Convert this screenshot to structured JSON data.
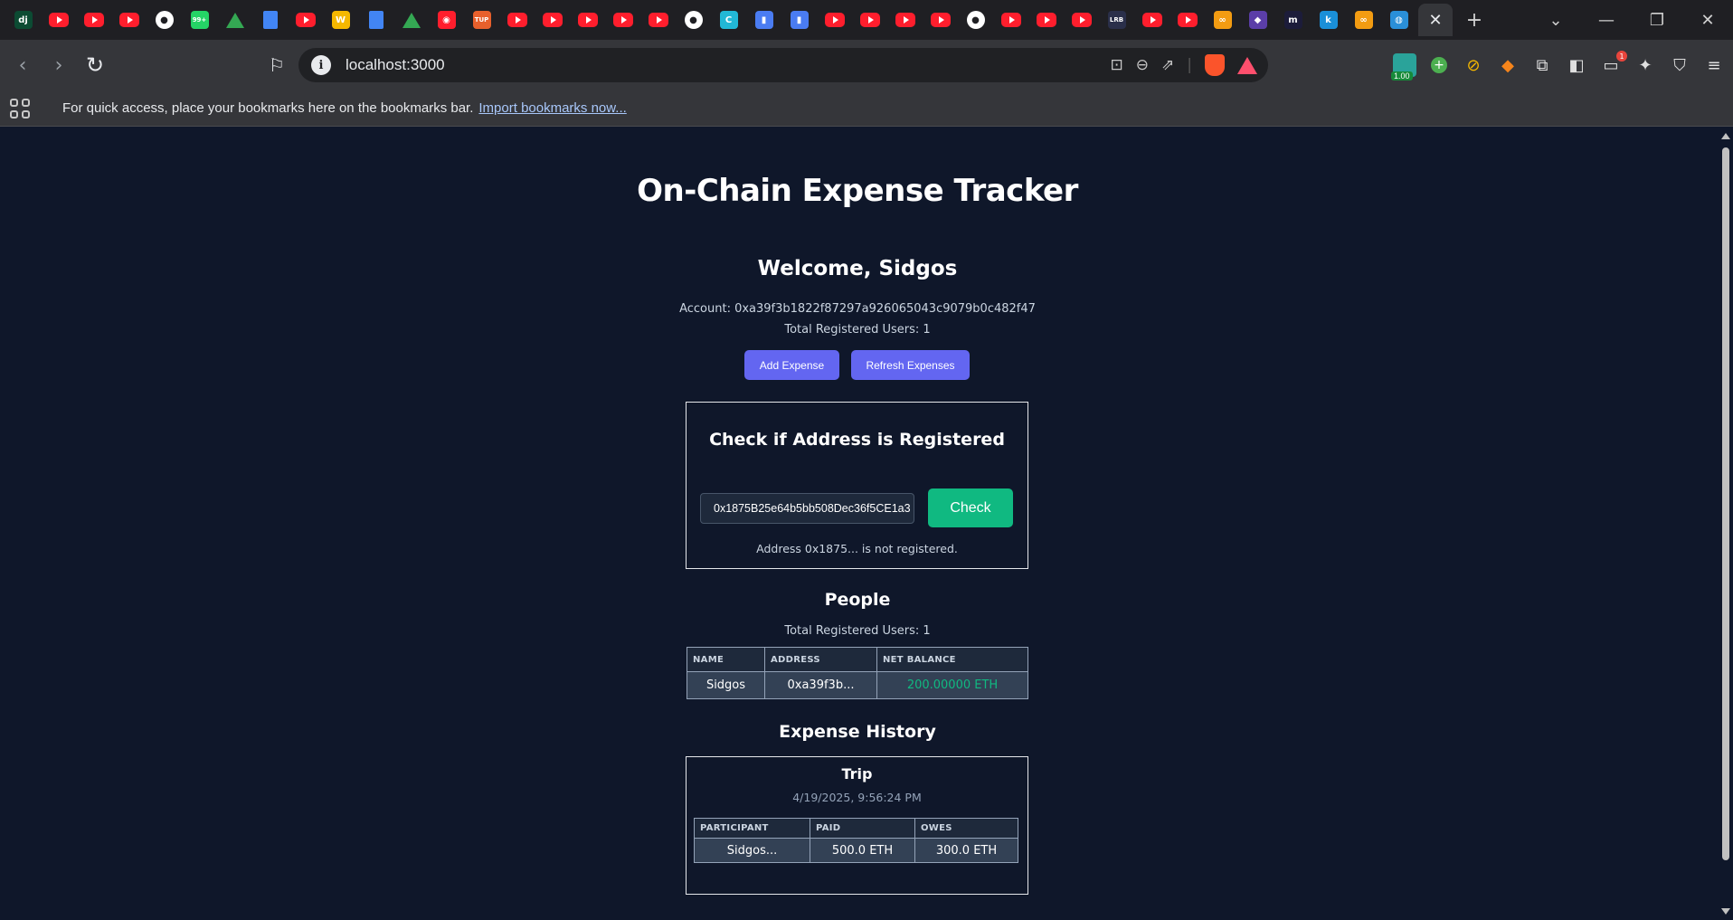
{
  "browser": {
    "tabs": [
      {
        "icon": "dj-icon",
        "glyph": "dj",
        "color": "#0c4b33"
      },
      {
        "icon": "youtube-icon"
      },
      {
        "icon": "youtube-icon"
      },
      {
        "icon": "youtube-icon"
      },
      {
        "icon": "github-icon"
      },
      {
        "icon": "green-chat-icon",
        "glyph": "99+",
        "color": "#25d366"
      },
      {
        "icon": "google-drive-icon"
      },
      {
        "icon": "google-docs-icon"
      },
      {
        "icon": "youtube-icon"
      },
      {
        "icon": "w-app-icon",
        "glyph": "W",
        "color": "#f5b800"
      },
      {
        "icon": "google-docs-icon"
      },
      {
        "icon": "google-drive-icon"
      },
      {
        "icon": "youtube-music-icon",
        "glyph": "◉",
        "color": "#ff1e2d"
      },
      {
        "icon": "tup-icon",
        "glyph": "TUP",
        "color": "#e8602c"
      },
      {
        "icon": "youtube-icon"
      },
      {
        "icon": "youtube-icon"
      },
      {
        "icon": "youtube-icon"
      },
      {
        "icon": "youtube-icon"
      },
      {
        "icon": "youtube-icon"
      },
      {
        "icon": "github-icon"
      },
      {
        "icon": "c-app-icon",
        "glyph": "C",
        "color": "#22b8d6"
      },
      {
        "icon": "bar-chart-icon",
        "glyph": "▮",
        "color": "#4a7cf2"
      },
      {
        "icon": "bar-chart-icon",
        "glyph": "▮",
        "color": "#4a7cf2"
      },
      {
        "icon": "youtube-icon"
      },
      {
        "icon": "youtube-icon"
      },
      {
        "icon": "youtube-icon"
      },
      {
        "icon": "youtube-icon"
      },
      {
        "icon": "github-icon"
      },
      {
        "icon": "youtube-icon"
      },
      {
        "icon": "youtube-icon"
      },
      {
        "icon": "youtube-icon"
      },
      {
        "icon": "lrb-icon",
        "glyph": "LRB",
        "color": "#2a2f4a"
      },
      {
        "icon": "youtube-icon"
      },
      {
        "icon": "youtube-icon"
      },
      {
        "icon": "infinity-icon",
        "glyph": "∞",
        "color": "#f39c12"
      },
      {
        "icon": "gamepad-icon",
        "glyph": "◆",
        "color": "#5b3ea8"
      },
      {
        "icon": "m-app-icon",
        "glyph": "m",
        "color": "#1c1c3a"
      },
      {
        "icon": "k-app-icon",
        "glyph": "k",
        "color": "#1a8fd8"
      },
      {
        "icon": "infinity-icon",
        "glyph": "∞",
        "color": "#f39c12"
      },
      {
        "icon": "globe-icon",
        "glyph": "◍",
        "color": "#2a8fd8"
      }
    ],
    "active_tab_close": "✕",
    "new_tab": "+",
    "url": "localhost:3000",
    "ext_badge": "1.00",
    "notif_count": "1",
    "bookmarks_text": "For quick access, place your bookmarks here on the bookmarks bar.",
    "bookmarks_link": "Import bookmarks now..."
  },
  "app": {
    "title": "On-Chain Expense Tracker",
    "welcome": "Welcome, Sidgos",
    "account": "Account: 0xa39f3b1822f87297a926065043c9079b0c482f47",
    "total_users": "Total Registered Users: 1",
    "add_expense": "Add Expense",
    "refresh_expenses": "Refresh Expenses",
    "check_card": {
      "title": "Check if Address is Registered",
      "input_value": "0x1875B25e64b5bb508Dec36f5CE1a3",
      "check_label": "Check",
      "result": "Address 0x1875... is not registered."
    },
    "people": {
      "title": "People",
      "total_users": "Total Registered Users: 1",
      "columns": [
        "NAME",
        "ADDRESS",
        "NET BALANCE"
      ],
      "rows": [
        {
          "name": "Sidgos",
          "address": "0xa39f3b...",
          "balance": "200.00000 ETH"
        }
      ]
    },
    "history": {
      "title": "Expense History",
      "expenses": [
        {
          "title": "Trip",
          "date": "4/19/2025, 9:56:24 PM",
          "columns": [
            "PARTICIPANT",
            "PAID",
            "OWES"
          ],
          "rows": [
            {
              "participant": "Sidgos...",
              "paid": "500.0 ETH",
              "owes": "300.0 ETH"
            }
          ]
        }
      ]
    }
  }
}
